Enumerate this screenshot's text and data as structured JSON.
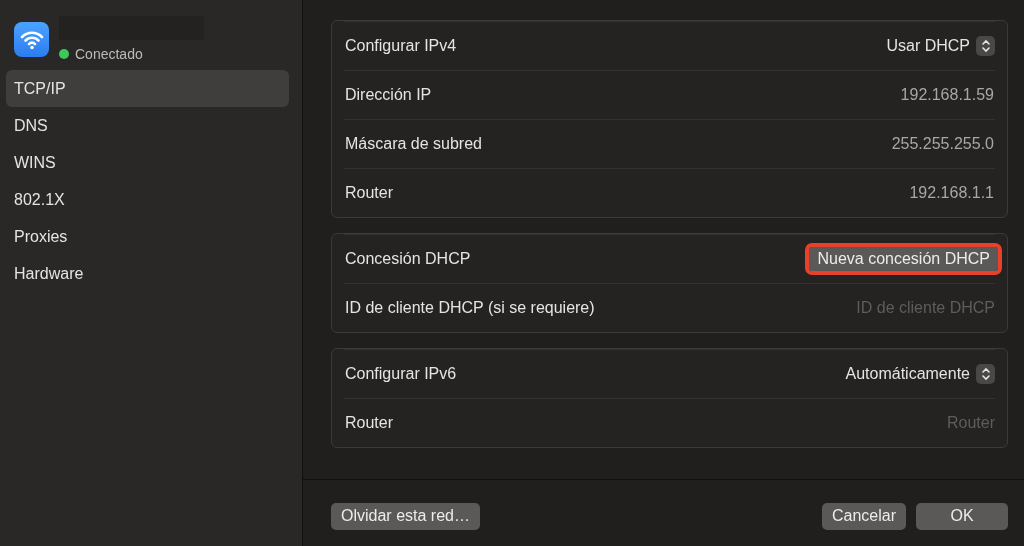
{
  "sidebar": {
    "network": {
      "status": "Conectado",
      "connected": true
    },
    "items": [
      {
        "label": "TCP/IP",
        "selected": true
      },
      {
        "label": "DNS",
        "selected": false
      },
      {
        "label": "WINS",
        "selected": false
      },
      {
        "label": "802.1X",
        "selected": false
      },
      {
        "label": "Proxies",
        "selected": false
      },
      {
        "label": "Hardware",
        "selected": false
      }
    ]
  },
  "groups": [
    {
      "rows": [
        {
          "kind": "popup",
          "label": "Configurar IPv4",
          "value": "Usar DHCP"
        },
        {
          "kind": "text",
          "label": "Dirección IP",
          "value": "192.168.1.59"
        },
        {
          "kind": "text",
          "label": "Máscara de subred",
          "value": "255.255.255.0"
        },
        {
          "kind": "text",
          "label": "Router",
          "value": "192.168.1.1"
        }
      ]
    },
    {
      "rows": [
        {
          "kind": "button",
          "label": "Concesión DHCP",
          "value": "Nueva concesión DHCP",
          "highlighted": true
        },
        {
          "kind": "field",
          "label": "ID de cliente DHCP (si se requiere)",
          "placeholder": "ID de cliente DHCP"
        }
      ]
    },
    {
      "rows": [
        {
          "kind": "popup",
          "label": "Configurar IPv6",
          "value": "Automáticamente"
        },
        {
          "kind": "field",
          "label": "Router",
          "placeholder": "Router"
        }
      ]
    }
  ],
  "footer": {
    "left_button": "Olvidar esta red…",
    "buttons": [
      "Cancelar",
      "OK"
    ]
  }
}
